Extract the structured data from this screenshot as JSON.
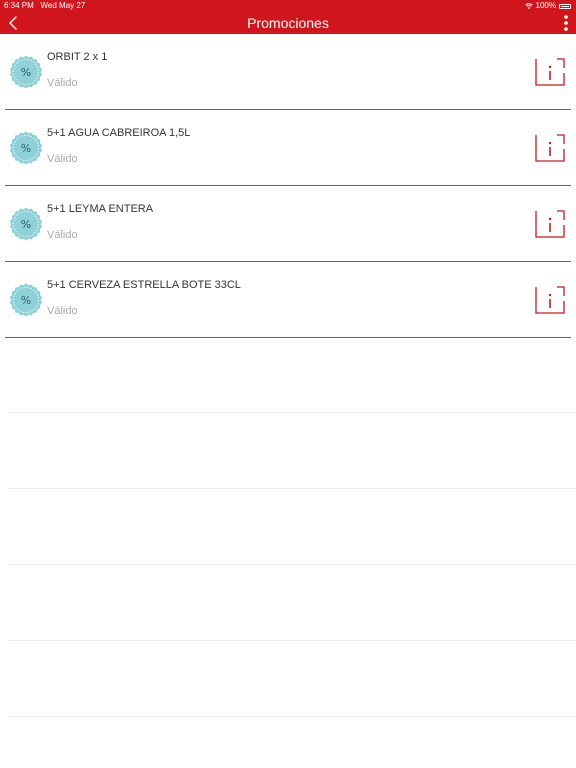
{
  "status_bar": {
    "time": "6:34 PM",
    "date": "Wed May 27",
    "battery": "100%"
  },
  "nav": {
    "title": "Promociones",
    "back_icon": "chevron-left-icon",
    "more_icon": "more-vertical-icon"
  },
  "colors": {
    "brand": "#d0161c",
    "separator": "#d6353a",
    "badge": "#8fd1d8",
    "muted": "#aaaaaa"
  },
  "promotions": [
    {
      "title": "ORBIT 2 x 1",
      "status": "Válido"
    },
    {
      "title": "5+1 AGUA CABREIROA 1,5L",
      "status": "Válido"
    },
    {
      "title": "5+1 LEYMA ENTERA",
      "status": "Válido"
    },
    {
      "title": "5+1 CERVEZA ESTRELLA BOTE 33CL",
      "status": "Válido"
    }
  ]
}
